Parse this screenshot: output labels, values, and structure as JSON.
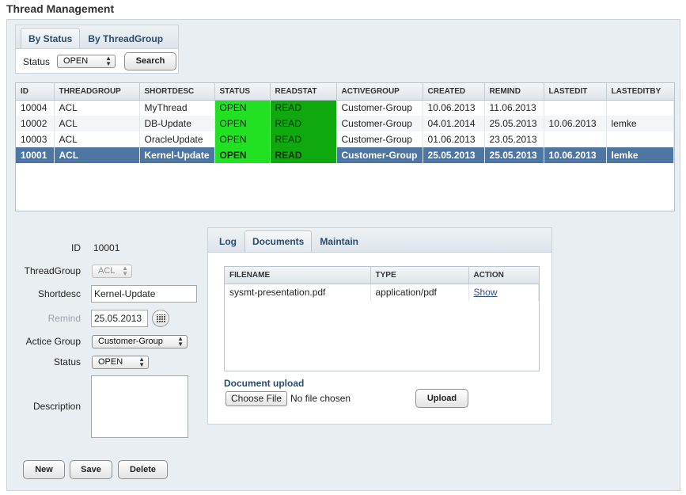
{
  "page": {
    "title": "Thread Management"
  },
  "filter": {
    "tabs": [
      "By Status",
      "By ThreadGroup"
    ],
    "status_label": "Status",
    "status_value": "OPEN",
    "search_label": "Search"
  },
  "threads": {
    "columns": [
      "ID",
      "THREADGROUP",
      "SHORTDESC",
      "STATUS",
      "READSTAT",
      "ACTIVEGROUP",
      "CREATED",
      "REMIND",
      "LASTEDIT",
      "LASTEDITBY"
    ],
    "rows": [
      [
        "10004",
        "ACL",
        "MyThread",
        "OPEN",
        "READ",
        "Customer-Group",
        "10.06.2013",
        "11.06.2013",
        "",
        ""
      ],
      [
        "10002",
        "ACL",
        "DB-Update",
        "OPEN",
        "READ",
        "Customer-Group",
        "04.01.2014",
        "25.05.2013",
        "10.06.2013",
        "lemke"
      ],
      [
        "10003",
        "ACL",
        "OracleUpdate",
        "OPEN",
        "READ",
        "Customer-Group",
        "01.06.2013",
        "23.05.2013",
        "",
        ""
      ],
      [
        "10001",
        "ACL",
        "Kernel-Update",
        "OPEN",
        "READ",
        "Customer-Group",
        "25.05.2013",
        "25.05.2013",
        "10.06.2013",
        "lemke"
      ]
    ],
    "selected_row": 3,
    "status_color": "#22e022",
    "readstat_color": "#0fa80f",
    "selected_color": "#4e76a3"
  },
  "detail": {
    "id_label": "ID",
    "id_value": "10001",
    "threadgroup_label": "ThreadGroup",
    "threadgroup_value": "ACL",
    "shortdesc_label": "Shortdesc",
    "shortdesc_value": "Kernel-Update",
    "remind_label": "Remind",
    "remind_value": "25.05.2013",
    "active_group_label": "Actice Group",
    "active_group_value": "Customer-Group",
    "status_label": "Status",
    "status_value": "OPEN",
    "description_label": "Description",
    "description_value": "",
    "buttons": {
      "new": "New",
      "save": "Save",
      "delete": "Delete"
    }
  },
  "documents": {
    "tabs": [
      "Log",
      "Documents",
      "Maintain"
    ],
    "active_tab": "Documents",
    "columns": [
      "FILENAME",
      "TYPE",
      "ACTION"
    ],
    "rows": [
      {
        "filename": "sysmt-presentation.pdf",
        "type": "application/pdf",
        "action": "Show"
      }
    ],
    "upload_label": "Document upload",
    "choose_file_label": "Choose File",
    "no_file_text": "No file chosen",
    "upload_button": "Upload"
  },
  "icons": {
    "calendar": "calendar-icon",
    "select_arrows": "select-arrows-icon"
  }
}
